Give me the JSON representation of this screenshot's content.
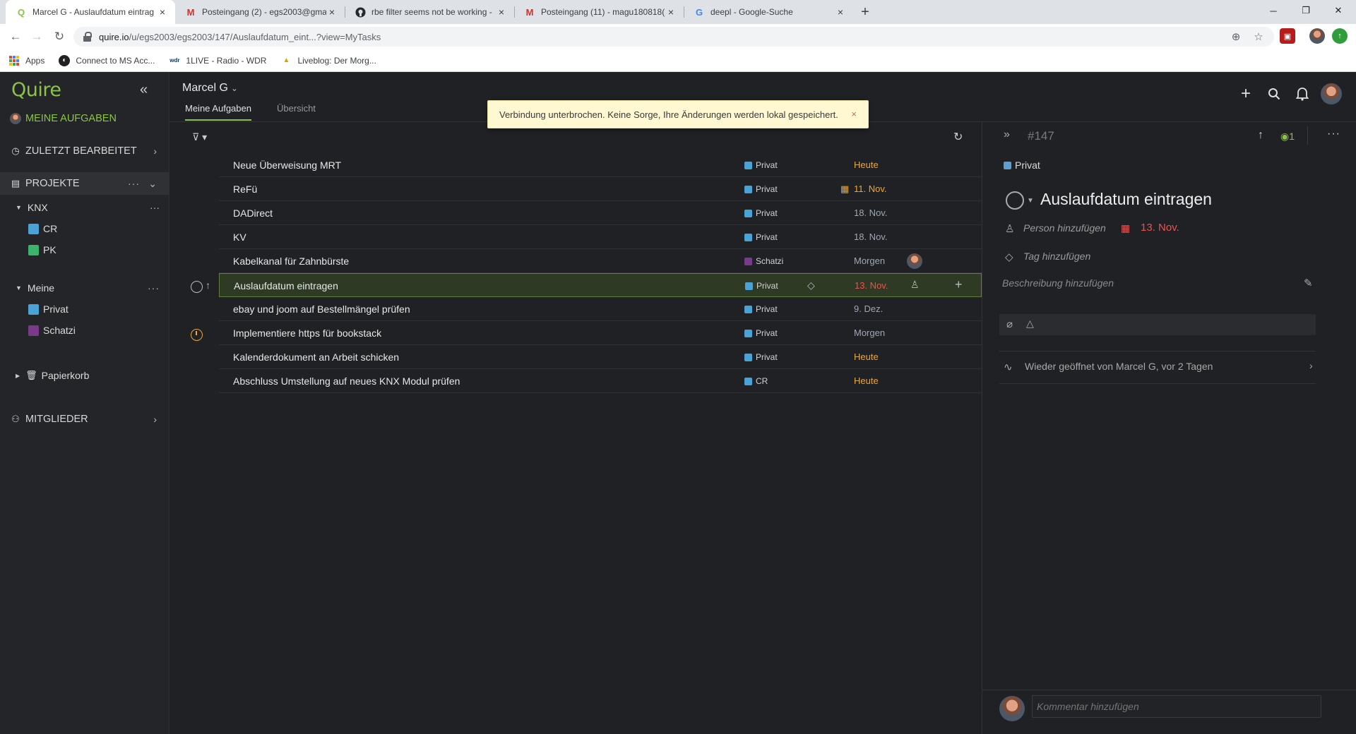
{
  "browser": {
    "tabs": [
      {
        "title": "Marcel G - Auslaufdatum eintrag",
        "favicon": "quire-icon",
        "active": true
      },
      {
        "title": "Posteingang (2) - egs2003@gma",
        "favicon": "gmail-icon",
        "active": false
      },
      {
        "title": "rbe filter seems not be working -",
        "favicon": "github-icon",
        "active": false
      },
      {
        "title": "Posteingang (11) - magu180818(",
        "favicon": "gmail-icon",
        "active": false
      },
      {
        "title": "deepl - Google-Suche",
        "favicon": "google-icon",
        "active": false
      }
    ],
    "url_host": "quire.io",
    "url_path": "/u/egs2003/egs2003/147/Auslaufdatum_eint...?view=MyTasks",
    "bookmarks": [
      {
        "label": "Apps",
        "icon": "apps-grid-icon"
      },
      {
        "label": "Connect to MS Acc...",
        "icon": "bookmark-icon"
      },
      {
        "label": "1LIVE - Radio - WDR",
        "icon": "wdr-icon"
      },
      {
        "label": "Liveblog: Der Morg...",
        "icon": "bookmark-icon"
      }
    ]
  },
  "sidebar": {
    "logo": "Quire",
    "my_tasks": "MEINE AUFGABEN",
    "recent": "ZULETZT BEARBEITET",
    "projects": "PROJEKTE",
    "groups": [
      {
        "name": "KNX",
        "projects": [
          {
            "name": "CR",
            "color": "#4aa3d6"
          },
          {
            "name": "PK",
            "color": "#3cb36a"
          }
        ]
      },
      {
        "name": "Meine",
        "projects": [
          {
            "name": "Privat",
            "color": "#4aa3d6"
          },
          {
            "name": "Schatzi",
            "color": "#7a3a8a"
          }
        ]
      }
    ],
    "trash": "Papierkorb",
    "members": "MITGLIEDER"
  },
  "header": {
    "user": "Marcel G",
    "tabs": [
      "Meine Aufgaben",
      "Übersicht"
    ]
  },
  "toast": {
    "message": "Verbindung unterbrochen. Keine Sorge, Ihre Änderungen werden lokal gespeichert.",
    "close": "×"
  },
  "tasks": [
    {
      "name": "Neue Überweisung MRT",
      "project": "Privat",
      "project_color": "#4aa3d6",
      "date": "Heute",
      "date_color": "orange"
    },
    {
      "name": "ReFü",
      "project": "Privat",
      "project_color": "#4aa3d6",
      "date": "11. Nov.",
      "date_color": "orange"
    },
    {
      "name": "DADirect",
      "project": "Privat",
      "project_color": "#4aa3d6",
      "date": "18. Nov.",
      "date_color": "gray"
    },
    {
      "name": "KV",
      "project": "Privat",
      "project_color": "#4aa3d6",
      "date": "18. Nov.",
      "date_color": "gray"
    },
    {
      "name": "Kabelkanal für Zahnbürste",
      "project": "Schatzi",
      "project_color": "#7a3a8a",
      "date": "Morgen",
      "date_color": "gray"
    },
    {
      "name": "Auslaufdatum eintragen",
      "project": "Privat",
      "project_color": "#4aa3d6",
      "date": "13. Nov.",
      "date_color": "red"
    },
    {
      "name": "ebay und joom auf Bestellmängel prüfen",
      "project": "Privat",
      "project_color": "#4aa3d6",
      "date": "9. Dez.",
      "date_color": "gray"
    },
    {
      "name": "Implementiere https für bookstack",
      "project": "Privat",
      "project_color": "#4aa3d6",
      "date": "Morgen",
      "date_color": "gray"
    },
    {
      "name": "Kalenderdokument an Arbeit schicken",
      "project": "Privat",
      "project_color": "#4aa3d6",
      "date": "Heute",
      "date_color": "orange"
    },
    {
      "name": "Abschluss Umstellung auf neues KNX Modul prüfen",
      "project": "CR",
      "project_color": "#4aa3d6",
      "date": "Heute",
      "date_color": "orange"
    }
  ],
  "detail": {
    "id": "#147",
    "watchers": "1",
    "project": "Privat",
    "title": "Auslaufdatum eintragen",
    "add_person": "Person hinzufügen",
    "date": "13. Nov.",
    "add_tag": "Tag hinzufügen",
    "add_description": "Beschreibung hinzufügen",
    "activity": "Wieder geöffnet von Marcel G, vor 2 Tagen",
    "comment_placeholder": "Kommentar hinzufügen"
  }
}
